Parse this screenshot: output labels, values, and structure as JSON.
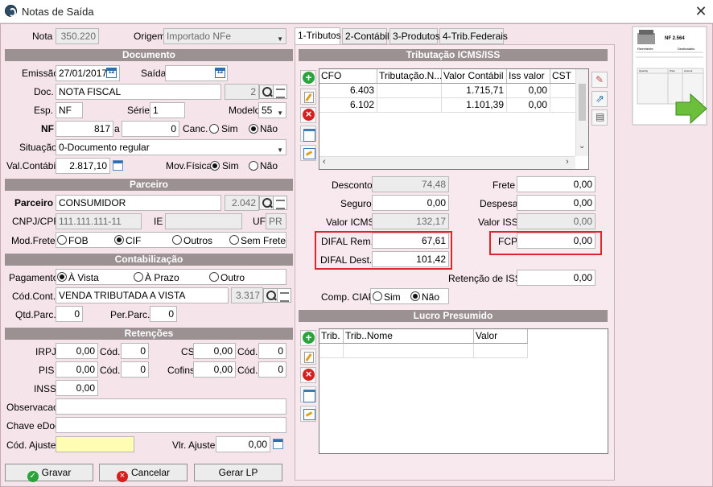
{
  "window": {
    "title": "Notas de Saída"
  },
  "left": {
    "nota_label": "Nota",
    "nota_value": "350.220",
    "origem_label": "Origem",
    "origem_value": "Importado NFe",
    "sec_documento": "Documento",
    "emissao_label": "Emissão",
    "emissao_value": "27/01/2017",
    "saida_label": "Saída",
    "saida_value": "",
    "doc_label": "Doc.",
    "doc_value": "NOTA FISCAL",
    "doc_code": "2",
    "esp_label": "Esp.",
    "esp_value": "NF",
    "serie_label": "Série",
    "serie_value": "1",
    "modelo_label": "Modelo",
    "modelo_value": "55",
    "nf_label": "NF",
    "nf_value": "817",
    "a_label": "a",
    "nf_to_value": "0",
    "canc_label": "Canc.",
    "sim": "Sim",
    "nao": "Não",
    "situacao_label": "Situação",
    "situacao_value": "0-Documento regular",
    "valcont_label": "Val.Contábil",
    "valcont_value": "2.817,10",
    "movfis_label": "Mov.Física",
    "sec_parceiro": "Parceiro",
    "parceiro_label": "Parceiro",
    "parceiro_value": "CONSUMIDOR",
    "parceiro_code": "2.042",
    "cnpj_label": "CNPJ/CPF",
    "cnpj_value": "111.111.111-11",
    "ie_label": "IE",
    "ie_value": "",
    "uf_label": "UF",
    "uf_value": "PR",
    "modfrete_label": "Mod.Frete",
    "fob": "FOB",
    "cif": "CIF",
    "outros": "Outros",
    "semfrete": "Sem Frete",
    "sec_contab": "Contabilização",
    "pagamento_label": "Pagamento",
    "avista": "À Vista",
    "aprazo": "À Prazo",
    "outro": "Outro",
    "codcont_label": "Cód.Cont.",
    "codcont_value": "VENDA TRIBUTADA A VISTA",
    "codcont_code": "3.317",
    "qtdparc_label": "Qtd.Parc.",
    "qtdparc_value": "0",
    "perparc_label": "Per.Parc.",
    "perparc_value": "0",
    "sec_retencoes": "Retenções",
    "irpj_label": "IRPJ",
    "irpj_value": "0,00",
    "cod_label": "Cód.",
    "irpj_cod": "0",
    "cs_label": "CS",
    "cs_value": "0,00",
    "cs_cod": "0",
    "pis_label": "PIS",
    "pis_value": "0,00",
    "pis_cod": "0",
    "cofins_label": "Cofins",
    "cofins_value": "0,00",
    "cofins_cod": "0",
    "inss_label": "INSS",
    "inss_value": "0,00",
    "obs_label": "Observacao",
    "obs_value": "",
    "chave_label": "Chave eDoc",
    "chave_value": "",
    "codajuste_label": "Cód. Ajuste",
    "codajuste_value": "",
    "vlrajuste_label": "Vlr. Ajuste",
    "vlrajuste_value": "0,00"
  },
  "buttons": {
    "gravar": "Gravar",
    "cancelar": "Cancelar",
    "gerar": "Gerar LP"
  },
  "tabs": [
    {
      "label": "1-Tributos"
    },
    {
      "label": "2-Contábil"
    },
    {
      "label": "3-Produtos"
    },
    {
      "label": "4-Trib.Federais"
    }
  ],
  "right": {
    "sec_trib": "Tributação ICMS/ISS",
    "grid_headers": [
      "CFO",
      "Tributação.N...",
      "Valor Contábil",
      "Iss valor",
      "CST"
    ],
    "grid_rows": [
      [
        "6.403",
        "",
        "1.715,71",
        "0,00",
        ""
      ],
      [
        "6.102",
        "",
        "1.101,39",
        "0,00",
        ""
      ]
    ],
    "desconto_label": "Desconto",
    "desconto_value": "74,48",
    "frete_label": "Frete",
    "frete_value": "0,00",
    "seguro_label": "Seguro",
    "seguro_value": "0,00",
    "despesa_label": "Despesa",
    "despesa_value": "0,00",
    "valicms_label": "Valor ICMS",
    "valicms_value": "132,17",
    "valiss_label": "Valor ISS",
    "valiss_value": "0,00",
    "difalrem_label": "DIFAL Rem.",
    "difalrem_value": "67,61",
    "fcp_label": "FCP",
    "fcp_value": "0,00",
    "difaldest_label": "DIFAL Dest.",
    "difaldest_value": "101,42",
    "retiss_label": "Retenção de ISS",
    "retiss_value": "0,00",
    "ciap_label": "Comp. CIAP",
    "sim": "Sim",
    "nao": "Não",
    "sec_lucro": "Lucro Presumido",
    "lucro_headers": [
      "Trib.",
      "Trib..Nome",
      "Valor"
    ]
  },
  "nf_image": {
    "title": "NF 2.564",
    "remetente": "Remetente",
    "destinatario": "Destinatário",
    "quantity": "Quantity",
    "price": "Price",
    "amount": "Amount"
  }
}
